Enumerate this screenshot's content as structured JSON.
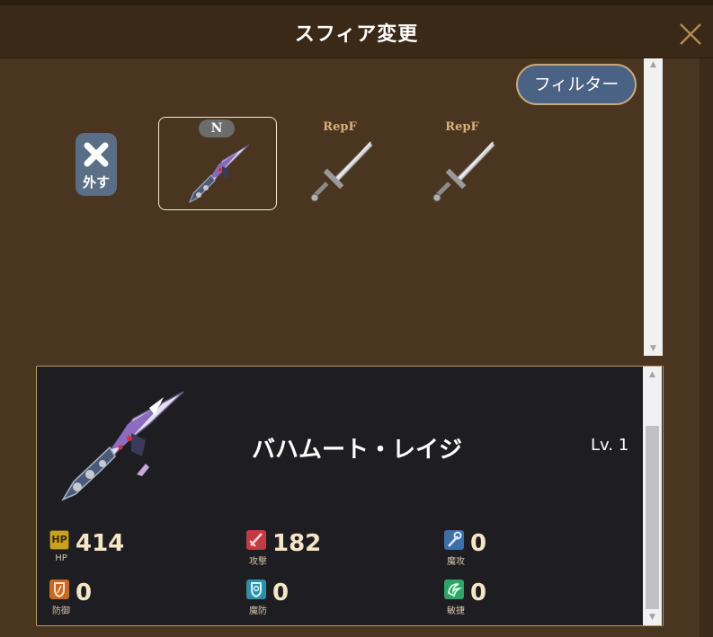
{
  "header": {
    "title": "スフィア変更"
  },
  "toolbar": {
    "filter_label": "フィルター",
    "remove_label": "外す"
  },
  "sphere_list": [
    {
      "rarity": "N",
      "name": "バハムート・レイジ",
      "selected": true
    },
    {
      "rarity": "RepF",
      "selected": false
    },
    {
      "rarity": "RepF",
      "selected": false
    }
  ],
  "detail": {
    "name": "バハムート・レイジ",
    "level": "Lv. 1",
    "stats": [
      {
        "key": "hp",
        "icon_text": "HP",
        "label": "HP",
        "value": "414",
        "color": "#c9a020"
      },
      {
        "key": "atk",
        "label": "攻撃",
        "value": "182",
        "color": "#c23a44"
      },
      {
        "key": "matk",
        "label": "魔攻",
        "value": "0",
        "color": "#3d6ea8"
      },
      {
        "key": "def",
        "label": "防御",
        "value": "0",
        "color": "#c56a24"
      },
      {
        "key": "mdef",
        "label": "魔防",
        "value": "0",
        "color": "#2f8fa6"
      },
      {
        "key": "agi",
        "label": "敏捷",
        "value": "0",
        "color": "#2ea468"
      }
    ]
  },
  "icons": {
    "close": "close-x-icon",
    "remove": "x-mark-icon",
    "weapon_rage": "bahamut-rage-weapon-icon",
    "weapon_sword": "sword-icon"
  }
}
